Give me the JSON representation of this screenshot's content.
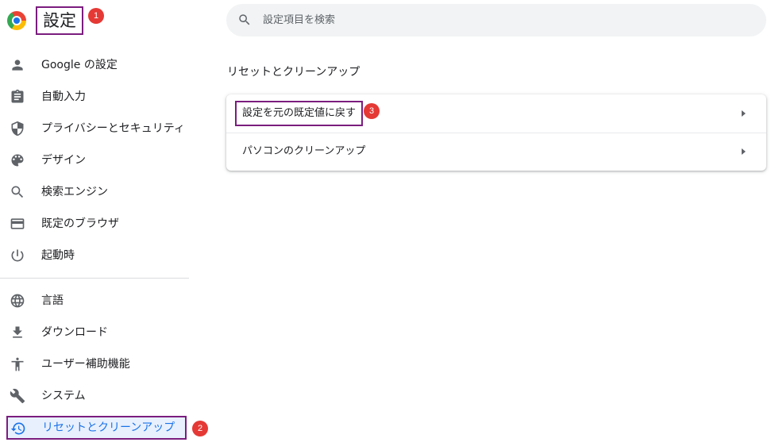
{
  "header": {
    "title": "設定"
  },
  "search": {
    "placeholder": "設定項目を検索"
  },
  "annotations": {
    "badge1": "1",
    "badge2": "2",
    "badge3": "3"
  },
  "sidebar": {
    "items": [
      {
        "label": "Google の設定",
        "icon": "person-icon"
      },
      {
        "label": "自動入力",
        "icon": "clipboard-icon"
      },
      {
        "label": "プライバシーとセキュリティ",
        "icon": "shield-icon"
      },
      {
        "label": "デザイン",
        "icon": "palette-icon"
      },
      {
        "label": "検索エンジン",
        "icon": "search-icon"
      },
      {
        "label": "既定のブラウザ",
        "icon": "browser-icon"
      },
      {
        "label": "起動時",
        "icon": "power-icon"
      },
      {
        "label": "言語",
        "icon": "globe-icon"
      },
      {
        "label": "ダウンロード",
        "icon": "download-icon"
      },
      {
        "label": "ユーザー補助機能",
        "icon": "accessibility-icon"
      },
      {
        "label": "システム",
        "icon": "wrench-icon"
      },
      {
        "label": "リセットとクリーンアップ",
        "icon": "restore-icon",
        "active": true
      }
    ]
  },
  "main": {
    "section_title": "リセットとクリーンアップ",
    "rows": [
      {
        "label": "設定を元の既定値に戻す"
      },
      {
        "label": "パソコンのクリーンアップ"
      }
    ]
  },
  "colors": {
    "accent": "#1a73e8",
    "highlight_border": "#7b1d7e",
    "badge": "#e53935"
  }
}
